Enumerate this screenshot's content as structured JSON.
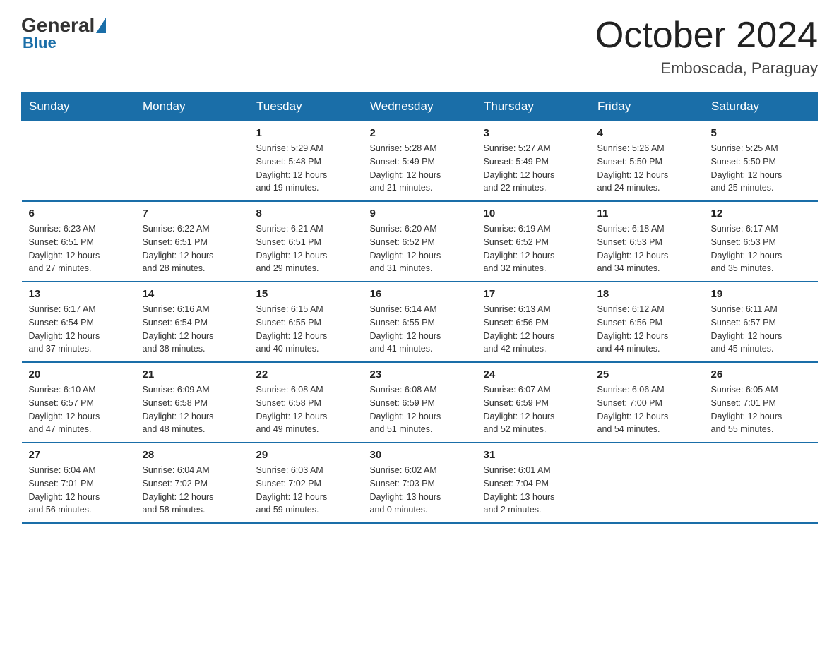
{
  "logo": {
    "general": "General",
    "blue": "Blue"
  },
  "header": {
    "month": "October 2024",
    "location": "Emboscada, Paraguay"
  },
  "days_of_week": [
    "Sunday",
    "Monday",
    "Tuesday",
    "Wednesday",
    "Thursday",
    "Friday",
    "Saturday"
  ],
  "weeks": [
    [
      {
        "day": "",
        "info": ""
      },
      {
        "day": "",
        "info": ""
      },
      {
        "day": "1",
        "info": "Sunrise: 5:29 AM\nSunset: 5:48 PM\nDaylight: 12 hours\nand 19 minutes."
      },
      {
        "day": "2",
        "info": "Sunrise: 5:28 AM\nSunset: 5:49 PM\nDaylight: 12 hours\nand 21 minutes."
      },
      {
        "day": "3",
        "info": "Sunrise: 5:27 AM\nSunset: 5:49 PM\nDaylight: 12 hours\nand 22 minutes."
      },
      {
        "day": "4",
        "info": "Sunrise: 5:26 AM\nSunset: 5:50 PM\nDaylight: 12 hours\nand 24 minutes."
      },
      {
        "day": "5",
        "info": "Sunrise: 5:25 AM\nSunset: 5:50 PM\nDaylight: 12 hours\nand 25 minutes."
      }
    ],
    [
      {
        "day": "6",
        "info": "Sunrise: 6:23 AM\nSunset: 6:51 PM\nDaylight: 12 hours\nand 27 minutes."
      },
      {
        "day": "7",
        "info": "Sunrise: 6:22 AM\nSunset: 6:51 PM\nDaylight: 12 hours\nand 28 minutes."
      },
      {
        "day": "8",
        "info": "Sunrise: 6:21 AM\nSunset: 6:51 PM\nDaylight: 12 hours\nand 29 minutes."
      },
      {
        "day": "9",
        "info": "Sunrise: 6:20 AM\nSunset: 6:52 PM\nDaylight: 12 hours\nand 31 minutes."
      },
      {
        "day": "10",
        "info": "Sunrise: 6:19 AM\nSunset: 6:52 PM\nDaylight: 12 hours\nand 32 minutes."
      },
      {
        "day": "11",
        "info": "Sunrise: 6:18 AM\nSunset: 6:53 PM\nDaylight: 12 hours\nand 34 minutes."
      },
      {
        "day": "12",
        "info": "Sunrise: 6:17 AM\nSunset: 6:53 PM\nDaylight: 12 hours\nand 35 minutes."
      }
    ],
    [
      {
        "day": "13",
        "info": "Sunrise: 6:17 AM\nSunset: 6:54 PM\nDaylight: 12 hours\nand 37 minutes."
      },
      {
        "day": "14",
        "info": "Sunrise: 6:16 AM\nSunset: 6:54 PM\nDaylight: 12 hours\nand 38 minutes."
      },
      {
        "day": "15",
        "info": "Sunrise: 6:15 AM\nSunset: 6:55 PM\nDaylight: 12 hours\nand 40 minutes."
      },
      {
        "day": "16",
        "info": "Sunrise: 6:14 AM\nSunset: 6:55 PM\nDaylight: 12 hours\nand 41 minutes."
      },
      {
        "day": "17",
        "info": "Sunrise: 6:13 AM\nSunset: 6:56 PM\nDaylight: 12 hours\nand 42 minutes."
      },
      {
        "day": "18",
        "info": "Sunrise: 6:12 AM\nSunset: 6:56 PM\nDaylight: 12 hours\nand 44 minutes."
      },
      {
        "day": "19",
        "info": "Sunrise: 6:11 AM\nSunset: 6:57 PM\nDaylight: 12 hours\nand 45 minutes."
      }
    ],
    [
      {
        "day": "20",
        "info": "Sunrise: 6:10 AM\nSunset: 6:57 PM\nDaylight: 12 hours\nand 47 minutes."
      },
      {
        "day": "21",
        "info": "Sunrise: 6:09 AM\nSunset: 6:58 PM\nDaylight: 12 hours\nand 48 minutes."
      },
      {
        "day": "22",
        "info": "Sunrise: 6:08 AM\nSunset: 6:58 PM\nDaylight: 12 hours\nand 49 minutes."
      },
      {
        "day": "23",
        "info": "Sunrise: 6:08 AM\nSunset: 6:59 PM\nDaylight: 12 hours\nand 51 minutes."
      },
      {
        "day": "24",
        "info": "Sunrise: 6:07 AM\nSunset: 6:59 PM\nDaylight: 12 hours\nand 52 minutes."
      },
      {
        "day": "25",
        "info": "Sunrise: 6:06 AM\nSunset: 7:00 PM\nDaylight: 12 hours\nand 54 minutes."
      },
      {
        "day": "26",
        "info": "Sunrise: 6:05 AM\nSunset: 7:01 PM\nDaylight: 12 hours\nand 55 minutes."
      }
    ],
    [
      {
        "day": "27",
        "info": "Sunrise: 6:04 AM\nSunset: 7:01 PM\nDaylight: 12 hours\nand 56 minutes."
      },
      {
        "day": "28",
        "info": "Sunrise: 6:04 AM\nSunset: 7:02 PM\nDaylight: 12 hours\nand 58 minutes."
      },
      {
        "day": "29",
        "info": "Sunrise: 6:03 AM\nSunset: 7:02 PM\nDaylight: 12 hours\nand 59 minutes."
      },
      {
        "day": "30",
        "info": "Sunrise: 6:02 AM\nSunset: 7:03 PM\nDaylight: 13 hours\nand 0 minutes."
      },
      {
        "day": "31",
        "info": "Sunrise: 6:01 AM\nSunset: 7:04 PM\nDaylight: 13 hours\nand 2 minutes."
      },
      {
        "day": "",
        "info": ""
      },
      {
        "day": "",
        "info": ""
      }
    ]
  ]
}
